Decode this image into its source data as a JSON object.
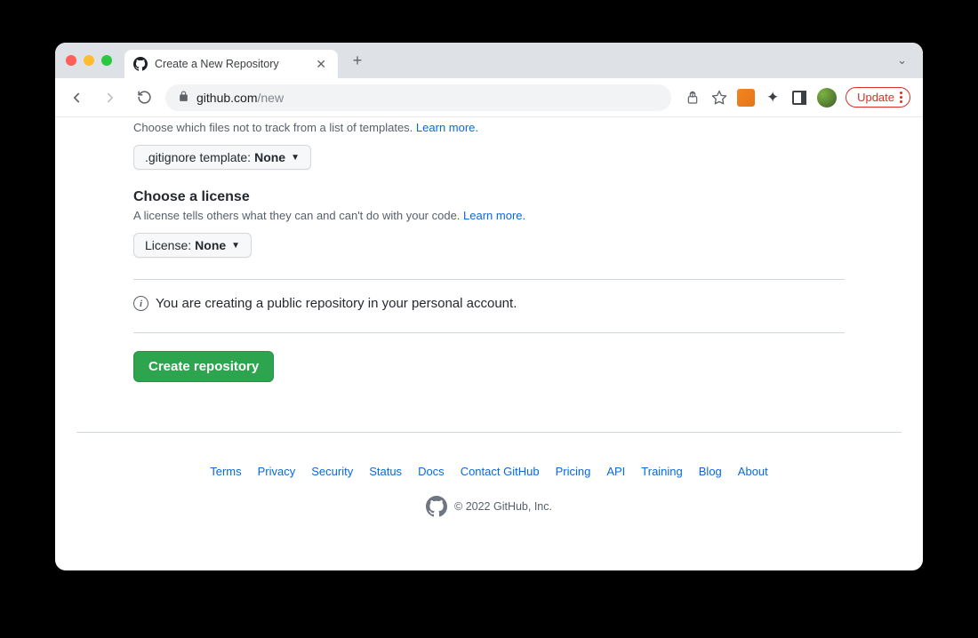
{
  "browser": {
    "tab_title": "Create a New Repository",
    "url_domain": "github.com",
    "url_path": "/new",
    "update_label": "Update"
  },
  "gitignore": {
    "help": "Choose which files not to track from a list of templates. ",
    "learn_more": "Learn more.",
    "button_prefix": ".gitignore template: ",
    "button_value": "None"
  },
  "license": {
    "title": "Choose a license",
    "help": "A license tells others what they can and can't do with your code. ",
    "learn_more": "Learn more.",
    "button_prefix": "License: ",
    "button_value": "None"
  },
  "info_text": "You are creating a public repository in your personal account.",
  "create_button": "Create repository",
  "footer": {
    "links": [
      "Terms",
      "Privacy",
      "Security",
      "Status",
      "Docs",
      "Contact GitHub",
      "Pricing",
      "API",
      "Training",
      "Blog",
      "About"
    ],
    "copyright": "© 2022 GitHub, Inc."
  }
}
